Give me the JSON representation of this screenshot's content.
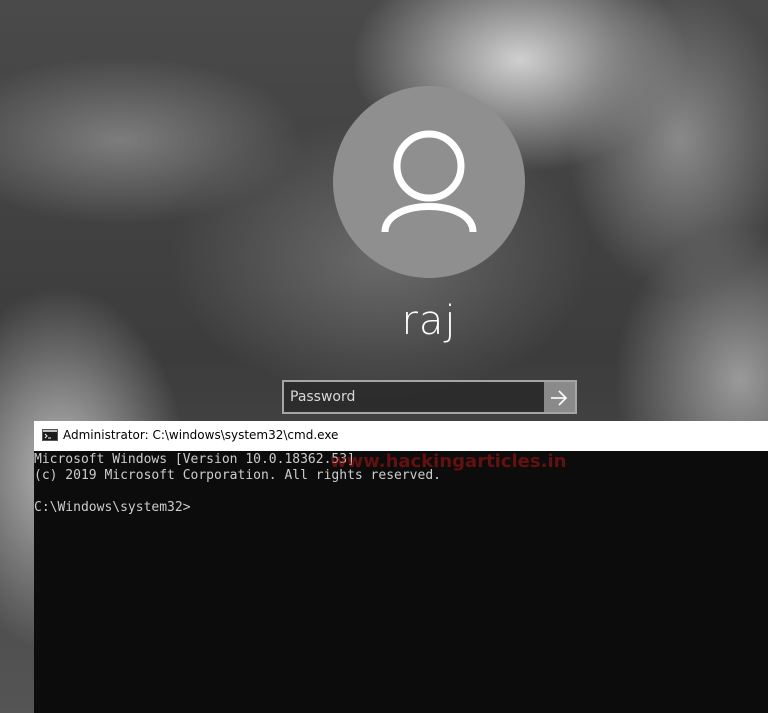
{
  "lock_screen": {
    "username": "raj",
    "password_placeholder": "Password",
    "password_value": "",
    "avatar_icon": "user-icon",
    "submit_icon": "arrow-right-icon"
  },
  "cmd_window": {
    "title": "Administrator: C:\\windows\\system32\\cmd.exe",
    "icon": "console-icon",
    "background": "#0c0c0c",
    "text_color": "#cccccc",
    "lines": [
      "Microsoft Windows [Version 10.0.18362.53]",
      "(c) 2019 Microsoft Corporation. All rights reserved.",
      "",
      "C:\\Windows\\system32>"
    ]
  },
  "watermark": {
    "text": "www.hackingarticles.in"
  }
}
